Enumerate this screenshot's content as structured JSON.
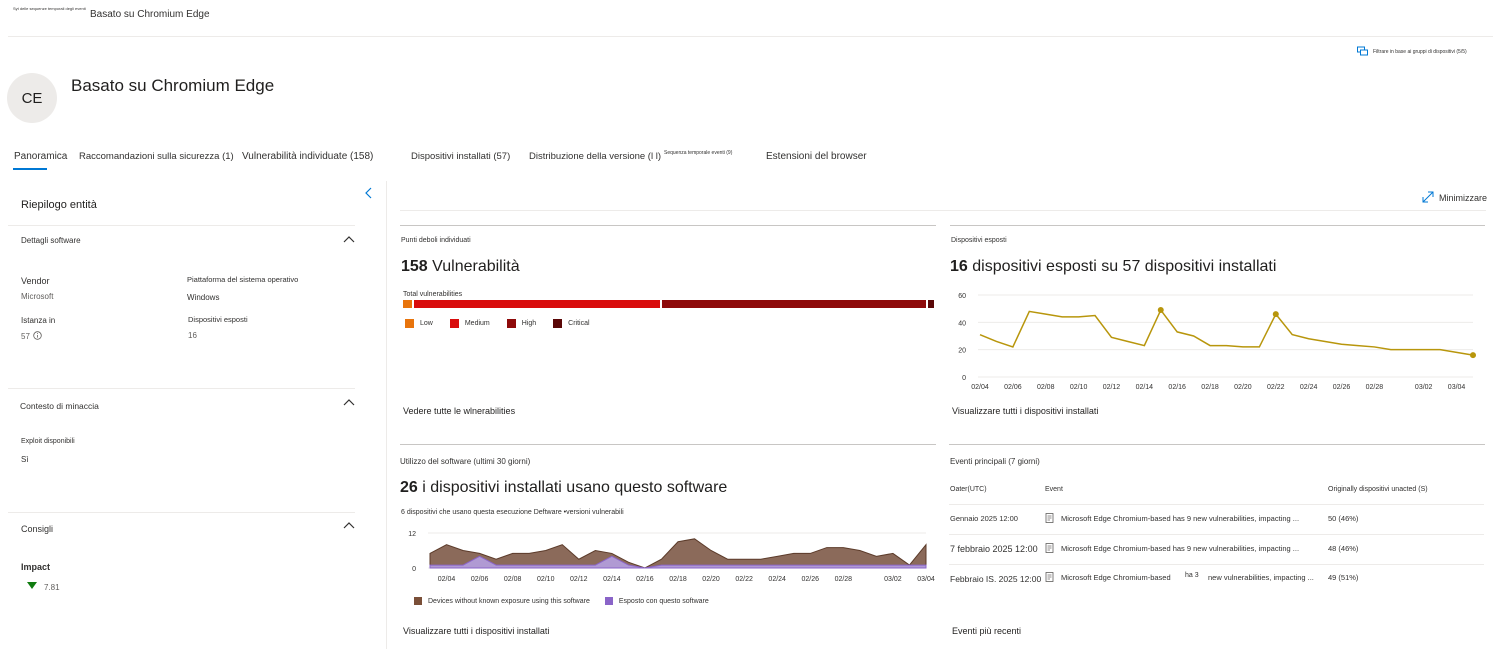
{
  "header": {
    "breadcrumb_small": "Syt delle sequenze temporali degli eventi",
    "breadcrumb": "Basato su Chromium Edge",
    "filter_label": "Filtrare in base ai gruppi di dispositivi (5/5)"
  },
  "entity": {
    "initials": "CE",
    "title": "Basato su Chromium Edge"
  },
  "tabs": [
    {
      "label": "Panoramica"
    },
    {
      "label": "Raccomandazioni sulla sicurezza (1)"
    },
    {
      "label": "Vulnerabilità individuate (158)"
    },
    {
      "label": "Dispositivi installati (57)"
    },
    {
      "label": "Distribuzione della versione (l l)"
    },
    {
      "label": "Sequenza temporale eventi (9)"
    },
    {
      "label": "Estensioni del browser"
    }
  ],
  "left_panel": {
    "title": "Riepilogo entità",
    "software_details": {
      "title": "Dettagli software",
      "vendor_label": "Vendor",
      "vendor_value": "Microsoft",
      "os_label": "Piattaforma del sistema operativo",
      "os_value": "Windows",
      "instances_label": "Istanza in",
      "instances_value": "57",
      "exposed_label": "Dispositivi esposti",
      "exposed_value": "16"
    },
    "threat_context": {
      "title": "Contesto di minaccia",
      "exploit_label": "Exploit disponibili",
      "exploit_value": "Sì"
    },
    "advice": {
      "title": "Consigli",
      "impact_label": "Impact",
      "impact_value": "7.81"
    }
  },
  "minimize_label": "Minimizzare",
  "vuln_card": {
    "label": "Punti deboli individuati",
    "count": "158",
    "count_text": "Vulnerabilità",
    "bar_label": "Total vulnerabilities",
    "segments": [
      {
        "name": "Low",
        "value": 3,
        "color": "#e8740c"
      },
      {
        "name": "Medium",
        "value": 78,
        "color": "#d90c0c"
      },
      {
        "name": "High",
        "value": 84,
        "color": "#8e0a0a"
      },
      {
        "name": "Critical",
        "value": 2,
        "color": "#5a0707"
      }
    ],
    "link": "Vedere tutte le wlnerabilities"
  },
  "exposed_card": {
    "label": "Dispositivi esposti",
    "count": "16",
    "count_text": "dispositivi esposti su 57 dispositivi installati",
    "link": "Visualizzare tutti i dispositivi installati"
  },
  "usage_card": {
    "label": "Utilizzo del software (ultimi 30 giorni)",
    "count": "26",
    "count_text": "i dispositivi installati usano questo software",
    "subtitle": "6 dispositivi  che  usano  questa  esecuzione  Deftware  •versioni  vulnerabili",
    "legend_a": "Devices without known exposure using this software",
    "legend_b": "Esposto con questo software",
    "link": "Visualizzare tutti i dispositivi installati"
  },
  "events_card": {
    "label": "Eventi principali (7 giorni)",
    "col_date": "Oater(UTC)",
    "col_event": "Event",
    "col_orig": "Originally dispositivi unacted (S)",
    "rows": [
      {
        "date": "Gennaio 2025 12:00",
        "event_a": "Microsoft Edge Chromium-based has 9 new vulnerabilities, impacting ...",
        "event_b": "",
        "event_c": "",
        "orig": "50 (46%)"
      },
      {
        "date": "7 febbraio 2025 12:00",
        "event_a": "Microsoft Edge Chromium-based has 9 new vulnerabilities, impacting ...",
        "event_b": "",
        "event_c": "",
        "orig": "48 (46%)"
      },
      {
        "date": "Febbraio IS. 2025 12:00",
        "event_a": "Microsoft Edge Chromium-based",
        "event_b": "ha 3",
        "event_c": "new vulnerabilities, impacting ...",
        "orig": "49 (51%)"
      }
    ],
    "link": "Eventi più recenti"
  },
  "chart_data": [
    {
      "type": "line",
      "title": "",
      "x": [
        "02/04",
        "02/05",
        "02/06",
        "02/07",
        "02/08",
        "02/09",
        "02/10",
        "02/11",
        "02/12",
        "02/13",
        "02/14",
        "02/15",
        "02/16",
        "02/17",
        "02/18",
        "02/19",
        "02/20",
        "02/21",
        "02/22",
        "02/23",
        "02/24",
        "02/25",
        "02/26",
        "02/27",
        "02/28",
        "02/29",
        "03/01",
        "03/02",
        "03/03",
        "03/04",
        "03/05"
      ],
      "series": [
        {
          "values": [
            31,
            26,
            22,
            48,
            46,
            44,
            44,
            45,
            29,
            26,
            23,
            49,
            33,
            30,
            23,
            23,
            22,
            22,
            46,
            31,
            28,
            26,
            24,
            23,
            22,
            20,
            20,
            20,
            20,
            18,
            16
          ]
        }
      ],
      "xticks": [
        "02/04",
        "02/06",
        "02/08",
        "02/10",
        "02/12",
        "02/14",
        "02/16",
        "02/18",
        "02/20",
        "02/22",
        "02/24",
        "02/26",
        "02/28",
        "03/02",
        "03/04"
      ],
      "yticks": [
        0,
        20,
        40,
        60
      ],
      "ylim": [
        0,
        60
      ],
      "color": "#b8960c",
      "grid": true
    },
    {
      "type": "area",
      "title": "",
      "x": [
        "02/03",
        "02/04",
        "02/05",
        "02/06",
        "02/07",
        "02/08",
        "02/09",
        "02/10",
        "02/11",
        "02/12",
        "02/13",
        "02/14",
        "02/15",
        "02/16",
        "02/17",
        "02/18",
        "02/19",
        "02/20",
        "02/21",
        "02/22",
        "02/23",
        "02/24",
        "02/25",
        "02/26",
        "02/27",
        "02/28",
        "02/29",
        "03/01",
        "03/02",
        "03/03",
        "03/04"
      ],
      "series": [
        {
          "name": "Devices without known exposure using this software",
          "values": [
            5,
            8,
            6,
            5,
            3,
            5,
            5,
            6,
            8,
            3,
            6,
            5,
            2,
            0,
            3,
            9,
            10,
            6,
            3,
            3,
            3,
            4,
            5,
            5,
            7,
            7,
            6,
            4,
            5,
            1,
            8
          ],
          "color": "#8b6a5a"
        },
        {
          "name": "Esposto con questo software",
          "values": [
            1,
            1,
            1,
            4,
            1,
            1,
            1,
            1,
            1,
            1,
            1,
            4,
            1,
            0,
            1,
            1,
            1,
            1,
            1,
            1,
            1,
            1,
            1,
            1,
            1,
            1,
            1,
            1,
            1,
            1,
            1
          ],
          "color": "#b4a0e0"
        }
      ],
      "xticks": [
        "02/04",
        "02/06",
        "02/08",
        "02/10",
        "02/12",
        "02/14",
        "02/16",
        "02/18",
        "02/20",
        "02/22",
        "02/24",
        "02/26",
        "02/28",
        "03/02",
        "03/04"
      ],
      "yticks": [
        0,
        12
      ],
      "ylim": [
        0,
        12
      ]
    }
  ]
}
